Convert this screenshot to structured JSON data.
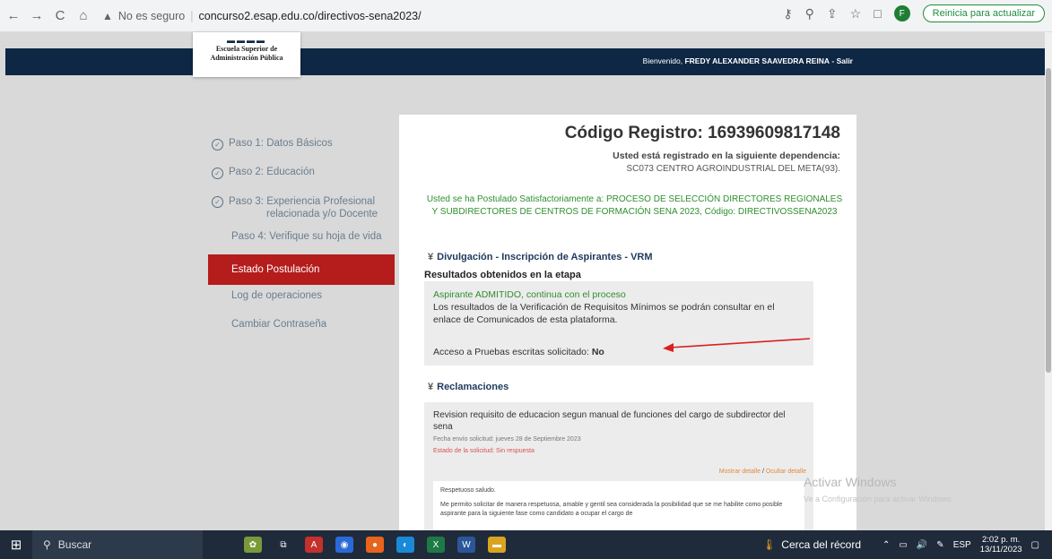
{
  "browser": {
    "nav_back": "←",
    "nav_forward": "→",
    "nav_reload": "C",
    "nav_home": "⌂",
    "security_label": "No es seguro",
    "url": "concurso2.esap.edu.co/directivos-sena2023/",
    "profile_initial": "F",
    "update_label": "Reinicia para actualizar"
  },
  "header": {
    "logo_line1": "Escuela Superior de",
    "logo_line2": "Administración Pública",
    "welcome_prefix": "Bienvenido,",
    "user_name": "FREDY ALEXANDER SAAVEDRA REINA",
    "logout": "- Salir"
  },
  "sidebar": {
    "items": [
      {
        "label": "Paso 1: Datos Básicos"
      },
      {
        "label": "Paso 2: Educación"
      },
      {
        "label": "Paso 3: Experiencia Profesional",
        "label2": "relacionada y/o Docente"
      },
      {
        "label": "Paso 4: Verifique su hoja de vida"
      },
      {
        "label": "Estado Postulación"
      },
      {
        "label": "Log de operaciones"
      },
      {
        "label": "Cambiar Contraseña"
      }
    ]
  },
  "main": {
    "registration_code": "Código Registro: 16939609817148",
    "dependency_label": "Usted está registrado en la siguiente dependencia:",
    "dependency_value": "SC073 CENTRO AGROINDUSTRIAL DEL META(93).",
    "postulation_message": "Usted se ha Postulado Satisfactoriamente a: PROCESO DE SELECCIÓN DIRECTORES REGIONALES Y SUBDIRECTORES DE CENTROS DE FORMACIÓN SENA 2023, Código: DIRECTIVOSSENA2023",
    "divulgation_title": "Divulgación - Inscripción de Aspirantes - VRM",
    "results_label": "Resultados obtenidos en la etapa",
    "admitted_text": "Aspirante ADMITIDO, continua con el proceso",
    "requirements_text": "Los resultados de la Verificación de Requisitos Mínimos se podrán consultar en el enlace de Comunicados de esta plataforma.",
    "access_label": "Acceso a Pruebas escritas solicitado:",
    "access_value": "No",
    "claims_title": "Reclamaciones",
    "claim": {
      "title": "Revision requisito de educacion segun manual de funciones del cargo de subdirector del sena",
      "date": "Fecha envío solicitud: jueves 28 de Septiembre 2023",
      "state": "Estado de la solicitud: Sin respuesta",
      "show_details": "Mostrar detalle",
      "separator": "/",
      "hide_details": "Ocultar detalle",
      "greeting": "Respetuoso saludo.",
      "body": "Me permito solicitar de manera respetuosa, amable y gentil sea considerada la posibilidad que se me habilite como posible aspirante para la siguiente fase como candidato a ocupar el cargo de"
    }
  },
  "watermark": {
    "title": "Activar Windows",
    "subtitle": "Ve a Configuración para activar Windows."
  },
  "taskbar": {
    "search_placeholder": "Buscar",
    "weather": "Cerca del récord",
    "language": "ESP",
    "time": "2:02 p. m.",
    "date": "13/11/2023"
  }
}
